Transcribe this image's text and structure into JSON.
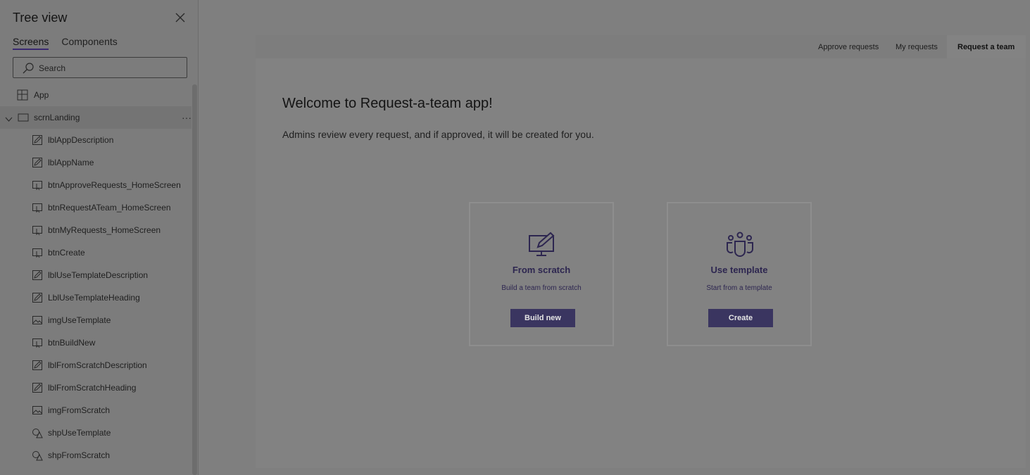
{
  "tree_view": {
    "title": "Tree view",
    "tabs": [
      {
        "label": "Screens",
        "active": true
      },
      {
        "label": "Components",
        "active": false
      }
    ],
    "search": {
      "placeholder": "Search",
      "value": ""
    },
    "items": [
      {
        "label": "App",
        "icon": "app-icon",
        "kind": "app"
      },
      {
        "label": "scrnLanding",
        "icon": "screen-icon",
        "kind": "screen",
        "expanded": true,
        "selected": true
      },
      {
        "label": "lblAppDescription",
        "icon": "label-icon",
        "kind": "control"
      },
      {
        "label": "lblAppName",
        "icon": "label-icon",
        "kind": "control"
      },
      {
        "label": "btnApproveRequests_HomeScreen",
        "icon": "button-icon",
        "kind": "control"
      },
      {
        "label": "btnRequestATeam_HomeScreen",
        "icon": "button-icon",
        "kind": "control"
      },
      {
        "label": "btnMyRequests_HomeScreen",
        "icon": "button-icon",
        "kind": "control"
      },
      {
        "label": "btnCreate",
        "icon": "button-icon",
        "kind": "control"
      },
      {
        "label": "lblUseTemplateDescription",
        "icon": "label-icon",
        "kind": "control"
      },
      {
        "label": "LblUseTemplateHeading",
        "icon": "label-icon",
        "kind": "control"
      },
      {
        "label": "imgUseTemplate",
        "icon": "image-icon",
        "kind": "control"
      },
      {
        "label": "btnBuildNew",
        "icon": "button-icon",
        "kind": "control"
      },
      {
        "label": "lblFromScratchDescription",
        "icon": "label-icon",
        "kind": "control"
      },
      {
        "label": "lblFromScratchHeading",
        "icon": "label-icon",
        "kind": "control"
      },
      {
        "label": "imgFromScratch",
        "icon": "image-icon",
        "kind": "control"
      },
      {
        "label": "shpUseTemplate",
        "icon": "shape-icon",
        "kind": "control"
      },
      {
        "label": "shpFromScratch",
        "icon": "shape-icon",
        "kind": "control"
      }
    ]
  },
  "app_screen": {
    "nav": [
      {
        "label": "Approve requests",
        "active": false
      },
      {
        "label": "My requests",
        "active": false
      },
      {
        "label": "Request a team",
        "active": true
      }
    ],
    "welcome_title": "Welcome to Request-a-team app!",
    "welcome_description": "Admins review every request, and if approved, it will be created for you.",
    "cards": [
      {
        "heading": "From scratch",
        "description": "Build a team from scratch",
        "button": "Build new",
        "icon": "pen-monitor-icon"
      },
      {
        "heading": "Use template",
        "description": "Start from a template",
        "button": "Create",
        "icon": "team-people-icon"
      }
    ]
  },
  "colors": {
    "overlay_dim": "#7f7f7f",
    "accent_purple": "#3a3560",
    "heading_purple": "#2d2650"
  }
}
